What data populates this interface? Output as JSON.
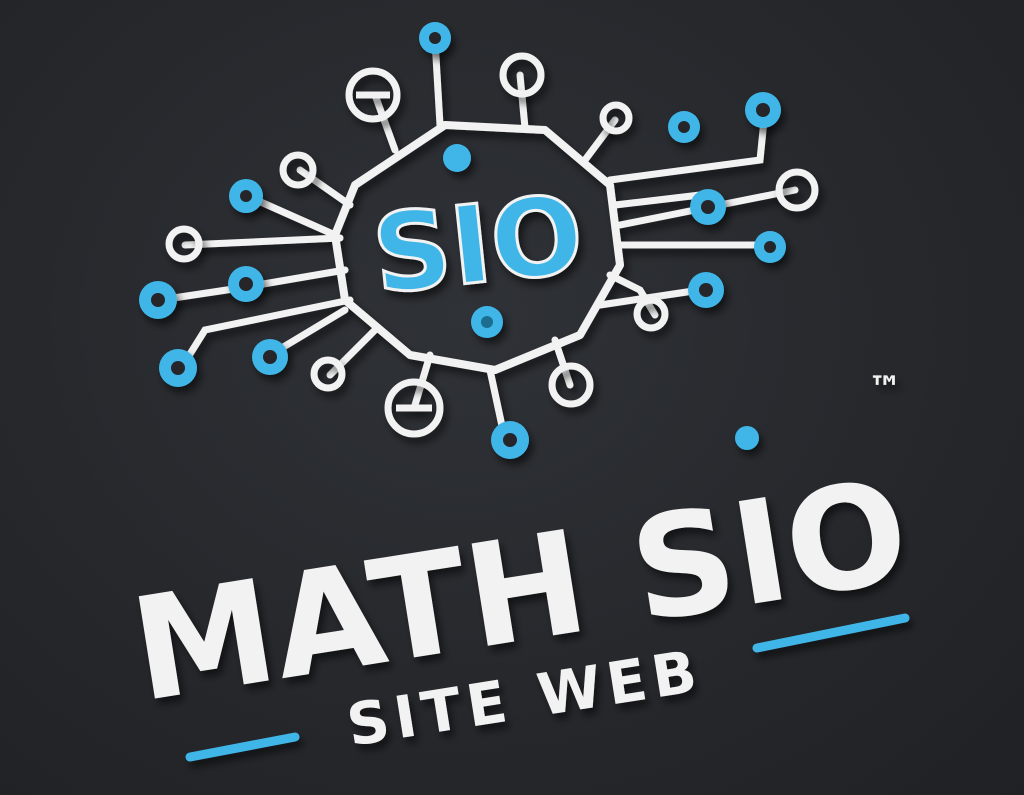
{
  "logo": {
    "emblem_text": "SIO",
    "brand_name": "MATH SIO",
    "trademark": "™",
    "tagline": "SITE WEB"
  },
  "colors": {
    "background": "#26282c",
    "accent": "#3fb6e8",
    "light": "#f2f2f2"
  },
  "icons": [
    "circuit-emblem-icon",
    "circuit-node-icon"
  ]
}
